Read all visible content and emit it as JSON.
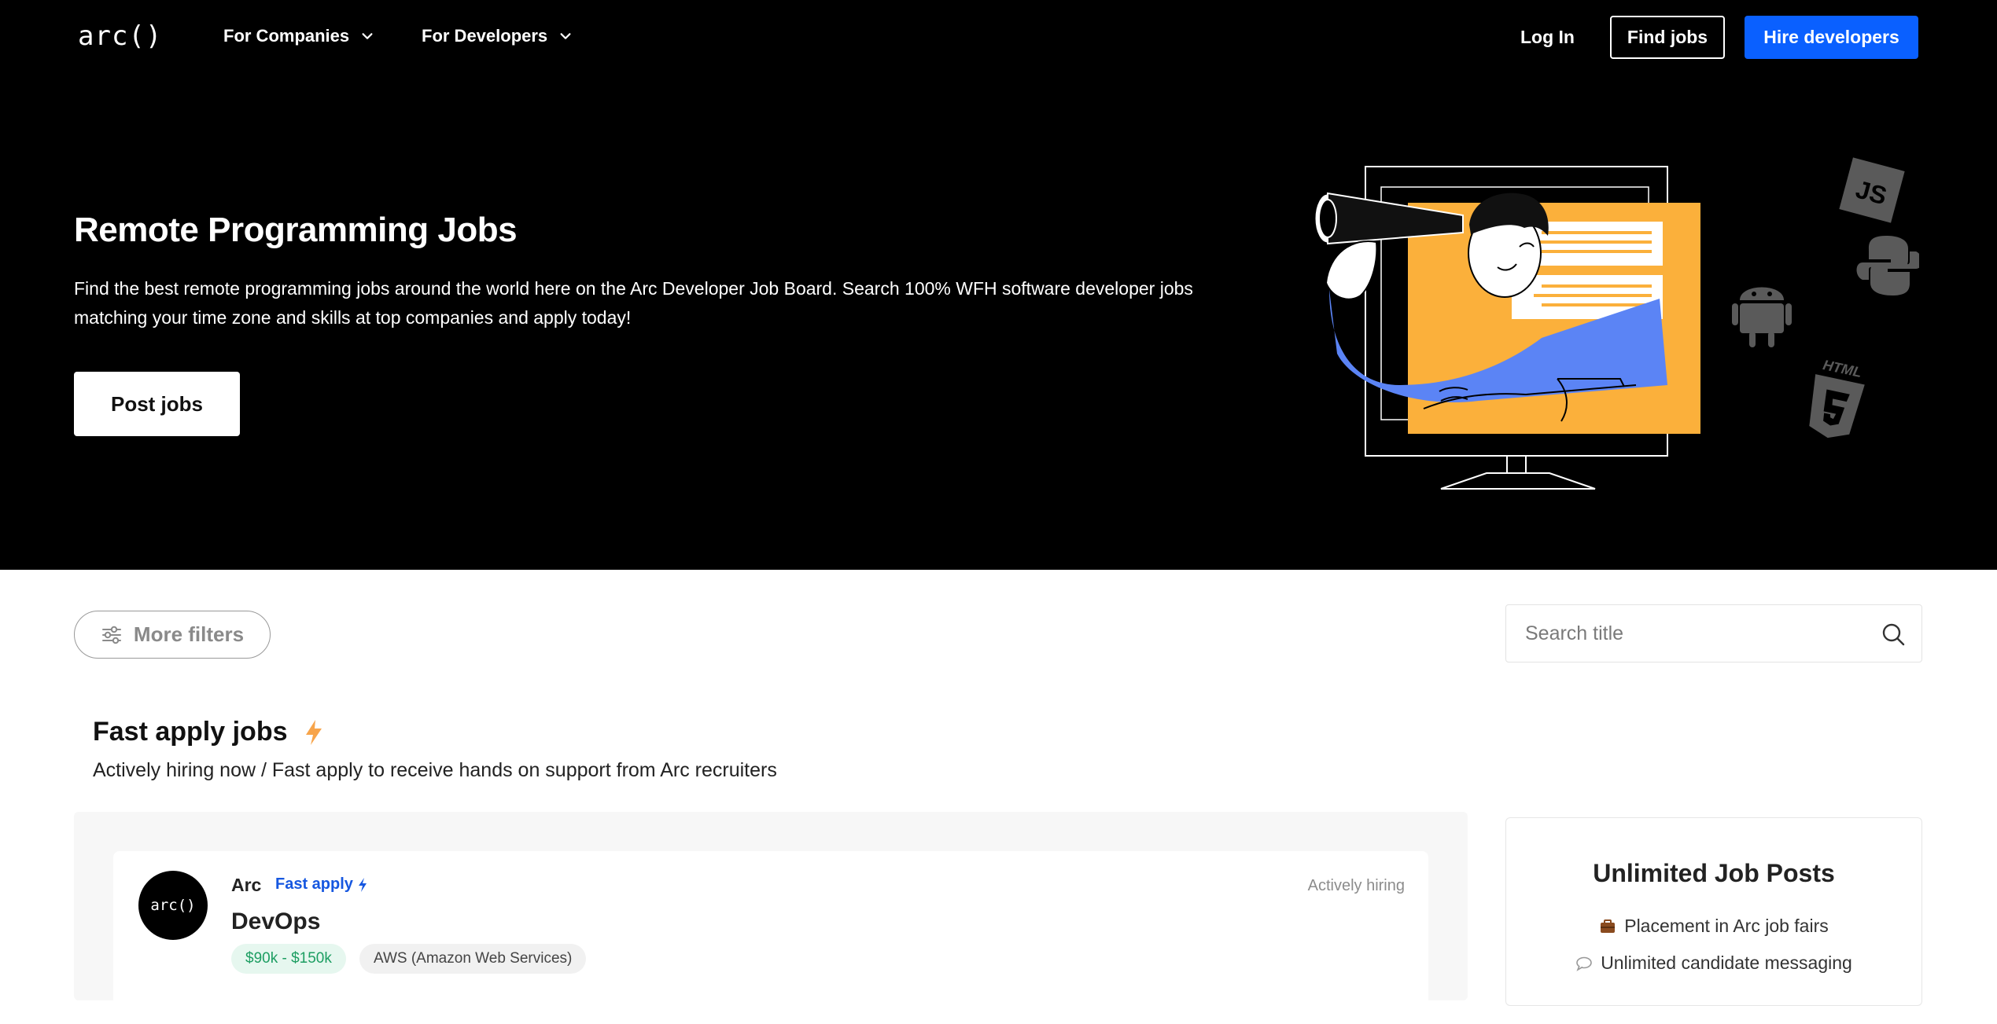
{
  "nav": {
    "logo": "arc()",
    "for_companies": "For Companies",
    "for_developers": "For Developers",
    "login": "Log In",
    "find_jobs": "Find jobs",
    "hire_developers": "Hire developers"
  },
  "hero": {
    "title": "Remote Programming Jobs",
    "description": "Find the best remote programming jobs around the world here on the Arc Developer Job Board. Search 100% WFH software developer jobs matching your time zone and skills at top companies and apply today!",
    "post_jobs": "Post jobs",
    "illustration_badges": [
      "JS",
      "HTML"
    ]
  },
  "filters": {
    "more_filters": "More filters",
    "search_placeholder": "Search title"
  },
  "fast_apply": {
    "title": "Fast apply jobs",
    "subtitle": "Actively hiring now / Fast apply to receive hands on support from Arc recruiters",
    "jobs": [
      {
        "company": "Arc",
        "avatar_text": "arc()",
        "badge": "Fast apply",
        "status": "Actively hiring",
        "title": "DevOps",
        "salary": "$90k - $150k",
        "skill": "AWS (Amazon Web Services)"
      }
    ]
  },
  "promo": {
    "title": "Unlimited Job Posts",
    "items": [
      "Placement in Arc job fairs",
      "Unlimited candidate messaging"
    ]
  },
  "colors": {
    "primary_blue": "#0a60ff",
    "hero_bg": "#000000",
    "accent_orange": "#f7a44a",
    "illustration_yellow": "#fbb03b",
    "illustration_blue": "#5b84f5",
    "salary_green": "#1d9e62"
  },
  "icons": [
    "chevron-down-icon",
    "filter-sliders-icon",
    "search-icon",
    "bolt-icon",
    "briefcase-icon",
    "chat-bubble-icon",
    "javascript-icon",
    "python-icon",
    "android-icon",
    "html5-icon"
  ]
}
